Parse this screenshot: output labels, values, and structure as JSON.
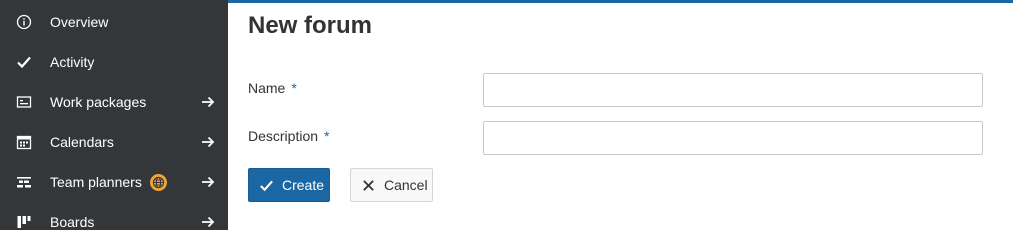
{
  "sidebar": {
    "items": [
      {
        "label": "Overview",
        "icon": "info-icon",
        "has_arrow": false
      },
      {
        "label": "Activity",
        "icon": "checkmark-icon",
        "has_arrow": false
      },
      {
        "label": "Work packages",
        "icon": "work-packages-icon",
        "has_arrow": true
      },
      {
        "label": "Calendars",
        "icon": "calendar-icon",
        "has_arrow": true
      },
      {
        "label": "Team planners",
        "icon": "team-planner-icon",
        "has_arrow": true,
        "badge_icon": "enterprise-globe-icon"
      },
      {
        "label": "Boards",
        "icon": "boards-icon",
        "has_arrow": true
      }
    ]
  },
  "main": {
    "title": "New forum",
    "fields": {
      "name": {
        "label": "Name",
        "required_mark": "*",
        "value": "",
        "placeholder": ""
      },
      "description": {
        "label": "Description",
        "required_mark": "*",
        "value": "",
        "placeholder": ""
      }
    },
    "buttons": {
      "create_label": "Create",
      "cancel_label": "Cancel"
    }
  },
  "colors": {
    "accent": "#1a67a3",
    "sidebar_bg": "#333739",
    "badge": "#f0a33a"
  }
}
